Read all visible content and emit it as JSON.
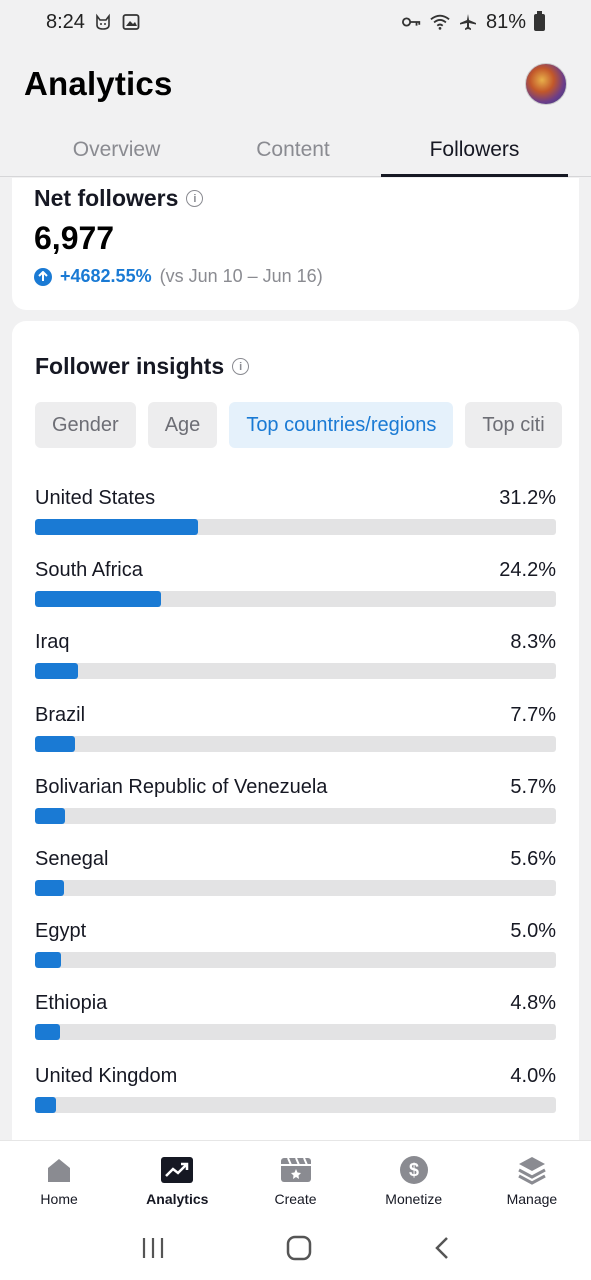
{
  "status_bar": {
    "time": "8:24",
    "battery": "81%",
    "left_icons": [
      "cat-notification-icon",
      "image-notification-icon"
    ],
    "right_icons": [
      "key-icon",
      "wifi-icon",
      "airplane-icon",
      "battery-icon"
    ]
  },
  "header": {
    "title": "Analytics"
  },
  "tabs": [
    {
      "label": "Overview",
      "active": false
    },
    {
      "label": "Content",
      "active": false
    },
    {
      "label": "Followers",
      "active": true
    }
  ],
  "net_followers": {
    "title": "Net followers",
    "value": "6,977",
    "change_pct": "+4682.55%",
    "change_range": "(vs Jun 10 – Jun 16)"
  },
  "follower_insights": {
    "title": "Follower insights",
    "chips": [
      {
        "label": "Gender",
        "active": false
      },
      {
        "label": "Age",
        "active": false
      },
      {
        "label": "Top countries/regions",
        "active": true
      },
      {
        "label": "Top citi",
        "active": false
      }
    ],
    "rows": [
      {
        "country": "United States",
        "value": "31.2%",
        "fraction": 0.312
      },
      {
        "country": "South Africa",
        "value": "24.2%",
        "fraction": 0.242
      },
      {
        "country": "Iraq",
        "value": "8.3%",
        "fraction": 0.083
      },
      {
        "country": "Brazil",
        "value": "7.7%",
        "fraction": 0.077
      },
      {
        "country": "Bolivarian Republic of Venezuela",
        "value": "5.7%",
        "fraction": 0.057
      },
      {
        "country": "Senegal",
        "value": "5.6%",
        "fraction": 0.056
      },
      {
        "country": "Egypt",
        "value": "5.0%",
        "fraction": 0.05
      },
      {
        "country": "Ethiopia",
        "value": "4.8%",
        "fraction": 0.048
      },
      {
        "country": "United Kingdom",
        "value": "4.0%",
        "fraction": 0.04
      }
    ]
  },
  "bottom_nav": [
    {
      "label": "Home",
      "icon": "home-icon",
      "active": false
    },
    {
      "label": "Analytics",
      "icon": "analytics-icon",
      "active": true
    },
    {
      "label": "Create",
      "icon": "create-icon",
      "active": false
    },
    {
      "label": "Monetize",
      "icon": "dollar-icon",
      "active": false
    },
    {
      "label": "Manage",
      "icon": "layers-icon",
      "active": false
    }
  ],
  "colors": {
    "accent": "#1a7ad4",
    "track": "#e3e3e4",
    "background": "#f1f1f2"
  }
}
